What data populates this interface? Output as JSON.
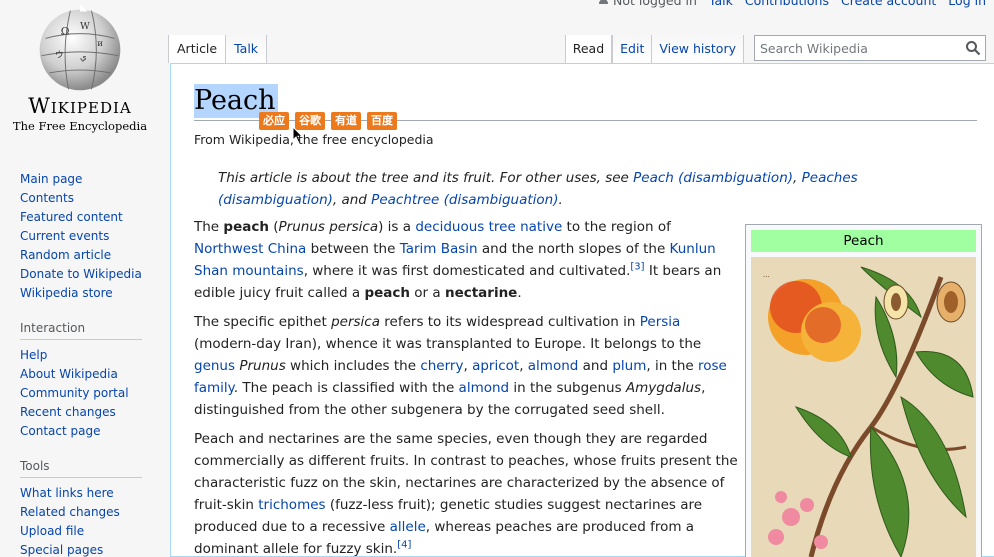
{
  "personal": {
    "not_logged_in": "Not logged in",
    "talk": "Talk",
    "contributions": "Contributions",
    "create_account": "Create account",
    "log_in": "Log in"
  },
  "logo": {
    "wordmark": "Wikipedia",
    "tagline": "The Free Encyclopedia"
  },
  "tabs": {
    "article": "Article",
    "talk": "Talk"
  },
  "views": {
    "read": "Read",
    "edit": "Edit",
    "history": "View history"
  },
  "search": {
    "placeholder": "Search Wikipedia",
    "value": ""
  },
  "sidebar": {
    "navigation": [
      {
        "label": "Main page"
      },
      {
        "label": "Contents"
      },
      {
        "label": "Featured content"
      },
      {
        "label": "Current events"
      },
      {
        "label": "Random article"
      },
      {
        "label": "Donate to Wikipedia"
      },
      {
        "label": "Wikipedia store"
      }
    ],
    "interaction_heading": "Interaction",
    "interaction": [
      {
        "label": "Help"
      },
      {
        "label": "About Wikipedia"
      },
      {
        "label": "Community portal"
      },
      {
        "label": "Recent changes"
      },
      {
        "label": "Contact page"
      }
    ],
    "tools_heading": "Tools",
    "tools": [
      {
        "label": "What links here"
      },
      {
        "label": "Related changes"
      },
      {
        "label": "Upload file"
      },
      {
        "label": "Special pages"
      }
    ]
  },
  "article": {
    "title": "Peach",
    "site_sub": "From Wikipedia, the free encyclopedia",
    "translate_buttons": [
      "必应",
      "谷歌",
      "有道",
      "百度"
    ],
    "hatnote": {
      "lead": "This article is about the tree and its fruit. For other uses, see ",
      "link1": "Peach (disambiguation)",
      "sep1": ", ",
      "link2": "Peaches (disambiguation)",
      "sep2": ", and ",
      "link3": "Peachtree (disambiguation)",
      "end": "."
    },
    "p1": {
      "t1": "The ",
      "b1": "peach",
      "t2": " (",
      "i1": "Prunus persica",
      "t3": ") is a ",
      "l1": "deciduous tree",
      "t4": " ",
      "l2": "native",
      "t5": " to the region of ",
      "l3": "Northwest China",
      "t6": " between the ",
      "l4": "Tarim Basin",
      "t7": " and the north slopes of the ",
      "l5": "Kunlun Shan mountains",
      "t8": ", where it was first domesticated and cultivated.",
      "ref": "[3]",
      "t9": " It bears an edible juicy fruit called a ",
      "b2": "peach",
      "t10": " or a ",
      "b3": "nectarine",
      "t11": "."
    },
    "p2": {
      "t1": "The specific epithet ",
      "i1": "persica",
      "t2": " refers to its widespread cultivation in ",
      "l1": "Persia",
      "t3": " (modern-day Iran), whence it was transplanted to Europe. It belongs to the ",
      "l2": "genus",
      "t4": " ",
      "i2": "Prunus",
      "t5": " which includes the ",
      "l3": "cherry",
      "t6": ", ",
      "l4": "apricot",
      "t7": ", ",
      "l5": "almond",
      "t8": " and ",
      "l6": "plum",
      "t9": ", in the ",
      "l7": "rose family",
      "t10": ". The peach is classified with the ",
      "l8": "almond",
      "t11": " in the subgenus ",
      "i3": "Amygdalus",
      "t12": ", distinguished from the other subgenera by the corrugated seed shell."
    },
    "p3": {
      "t1": "Peach and nectarines are the same species, even though they are regarded commercially as different fruits. In contrast to peaches, whose fruits present the characteristic fuzz on the skin, nectarines are characterized by the absence of fruit-skin ",
      "l1": "trichomes",
      "t2": " (fuzz-less fruit); genetic studies suggest nectarines are produced due to a recessive ",
      "l2": "allele",
      "t3": ", whereas peaches are produced from a dominant allele for fuzzy skin.",
      "ref": "[4]"
    }
  },
  "infobox": {
    "title": "Peach"
  },
  "colors": {
    "link": "#0645ad",
    "infobox_header": "#a0ffa0",
    "title_highlight": "#b4d5fe",
    "translate_button": "#ec7a1c"
  }
}
